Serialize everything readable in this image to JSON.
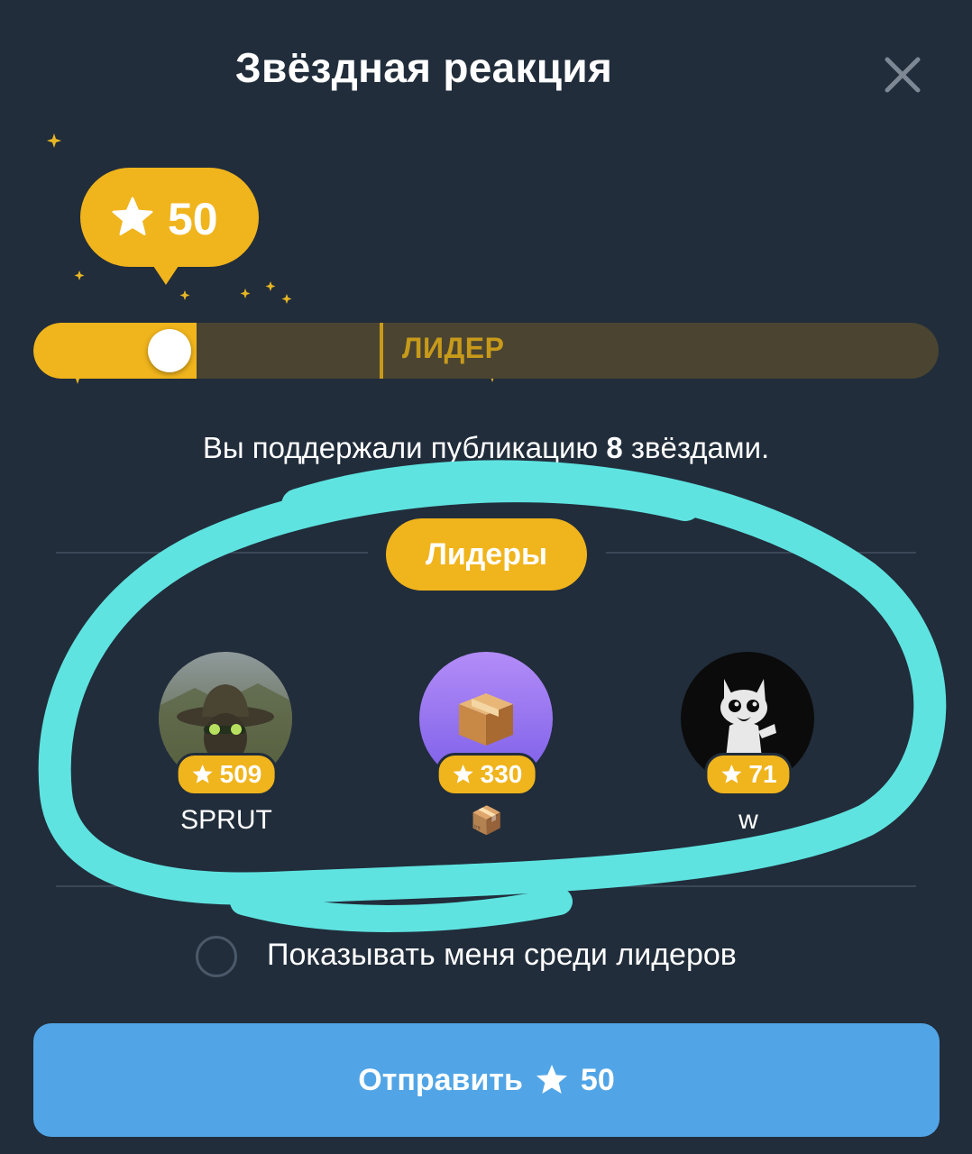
{
  "header": {
    "title": "Звёздная реакция"
  },
  "reaction": {
    "amount": "50",
    "slider_level": 0.15,
    "leader_label": "ЛИДЕР"
  },
  "support": {
    "prefix": "Вы поддержали публикацию ",
    "count": "8",
    "suffix": " звёздами."
  },
  "leaders": {
    "title": "Лидеры",
    "items": [
      {
        "name": "SPRUT",
        "stars": "509"
      },
      {
        "name": "📦",
        "stars": "330"
      },
      {
        "name": "w",
        "stars": "71"
      }
    ]
  },
  "show_me": {
    "label": "Показывать меня среди лидеров"
  },
  "send_button": {
    "label": "Отправить",
    "amount": "50"
  },
  "colors": {
    "background": "#212d3b",
    "gold": "#f0b41c",
    "button_blue": "#51a5e6",
    "annotation": "#5fe3e0"
  }
}
